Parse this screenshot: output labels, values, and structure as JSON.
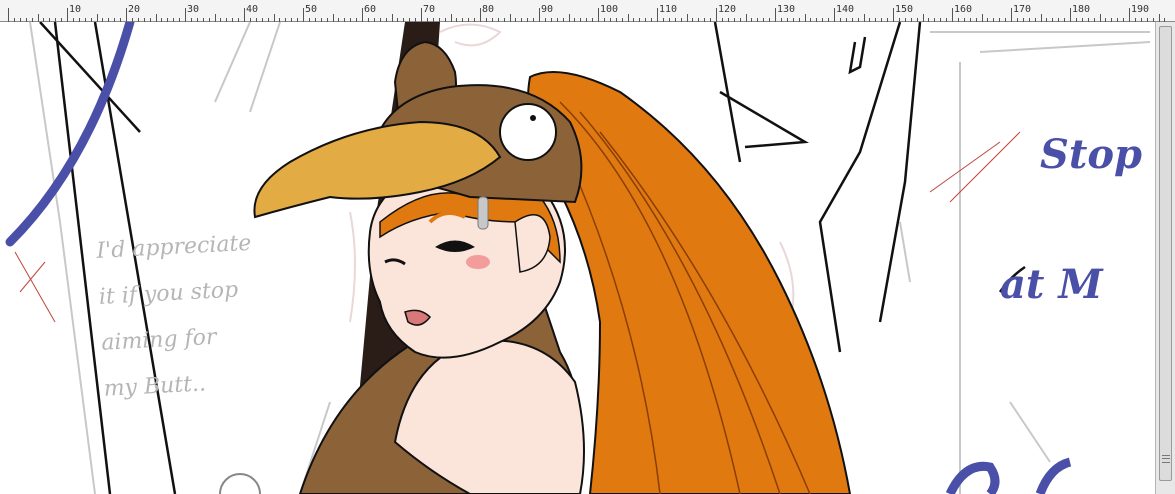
{
  "ruler": {
    "labels": [
      "10",
      "20",
      "30",
      "40",
      "50",
      "60",
      "70",
      "80",
      "90",
      "100",
      "110",
      "120",
      "130",
      "140",
      "150",
      "160",
      "170",
      "180",
      "190"
    ]
  },
  "canvas": {
    "sketch_text_left": [
      "I'd appreciate",
      "it if you stop",
      "aiming for",
      "my Butt.."
    ],
    "sketch_text_right": [
      "Stop",
      "at M"
    ]
  },
  "colors": {
    "ruler_bg": "#f4f4f4",
    "hair": "#e07a10",
    "hat": "#8c6239",
    "visor": "#e2ab44",
    "skin": "#fbe5da",
    "sketch_blue": "#4a4fa8",
    "sketch_gray": "#b8b8b8"
  }
}
